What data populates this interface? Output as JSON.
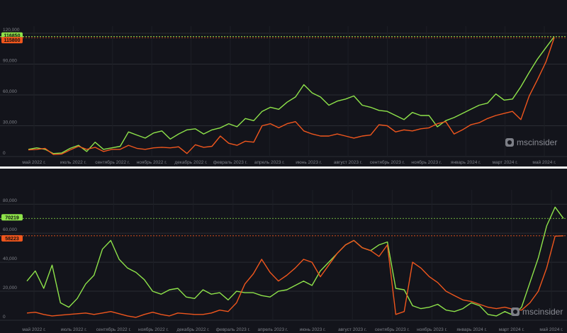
{
  "brand": "mscinsider",
  "colors": {
    "green": "#8ee34a",
    "orange": "#f0561d",
    "bg": "#13141b",
    "grid": "#2a2c33",
    "text": "#7f828a"
  },
  "chart_data": [
    {
      "type": "line",
      "x_labels": [
        "май 2022 г.",
        "июль 2022 г.",
        "сентябрь 2022 г.",
        "ноябрь 2022 г.",
        "декабрь 2022 г.",
        "февраль 2023 г.",
        "апрель 2023 г.",
        "июнь 2023 г.",
        "август 2023 г.",
        "сентябрь 2023 г.",
        "ноябрь 2023 г.",
        "январь 2024 г.",
        "март 2024 г.",
        "май 2024 г."
      ],
      "y_ticks": [
        "0",
        "30,000",
        "60,000",
        "90,000",
        "120,000"
      ],
      "ylim": [
        0,
        120000
      ],
      "last_values": [
        "116850",
        "115800"
      ],
      "series": [
        {
          "color": "#8ee34a",
          "values": [
            7000,
            8500,
            7000,
            3000,
            3500,
            8000,
            11000,
            5000,
            14000,
            7000,
            8500,
            10000,
            24000,
            21000,
            18000,
            23000,
            25000,
            17000,
            22000,
            26000,
            27000,
            22000,
            26000,
            28000,
            32000,
            29000,
            37000,
            35000,
            44000,
            48000,
            46000,
            53000,
            58000,
            70000,
            62000,
            58000,
            50000,
            54000,
            56000,
            59000,
            50000,
            48000,
            45000,
            44000,
            40000,
            36000,
            43000,
            40000,
            40000,
            29000,
            35000,
            38000,
            42000,
            46000,
            50000,
            52000,
            61000,
            55000,
            56000,
            68000,
            82000,
            95000,
            106000,
            116850
          ]
        },
        {
          "color": "#f0561d",
          "values": [
            6500,
            7000,
            8000,
            2000,
            2500,
            6500,
            10000,
            7000,
            9000,
            5000,
            7000,
            7000,
            11000,
            8000,
            7000,
            8500,
            9000,
            8500,
            9500,
            3000,
            11500,
            9000,
            10000,
            20000,
            13000,
            11000,
            15000,
            14000,
            30000,
            32000,
            28000,
            32000,
            34000,
            25000,
            22000,
            20000,
            20000,
            22000,
            20000,
            18000,
            20000,
            21000,
            31000,
            30000,
            24000,
            26000,
            25000,
            27000,
            28000,
            32000,
            34000,
            22000,
            26000,
            31000,
            33000,
            37000,
            40000,
            42000,
            44000,
            36000,
            59000,
            75000,
            92000,
            115800
          ]
        }
      ]
    },
    {
      "type": "line",
      "x_labels": [
        "май 2022 г.",
        "июль 2022 г.",
        "сентябрь 2022 г.",
        "ноябрь 2022 г.",
        "декабрь 2022 г.",
        "февраль 2023 г.",
        "апрель 2023 г.",
        "июнь 2023 г.",
        "август 2023 г.",
        "сентябрь 2023 г.",
        "ноябрь 2023 г.",
        "январь 2024 г.",
        "март 2024 г.",
        "май 2024 г."
      ],
      "y_ticks": [
        "0",
        "20,000",
        "40,000",
        "60,000",
        "80,000"
      ],
      "ylim": [
        0,
        85000
      ],
      "last_values": [
        "70219",
        "58223"
      ],
      "series": [
        {
          "color": "#8ee34a",
          "values": [
            27000,
            34000,
            22000,
            38000,
            12000,
            9000,
            15000,
            25000,
            31000,
            49000,
            55000,
            42000,
            36000,
            33000,
            28000,
            20000,
            18000,
            21000,
            22000,
            16000,
            15000,
            21000,
            18000,
            19000,
            14000,
            20000,
            19000,
            19000,
            17000,
            16000,
            20000,
            21000,
            24000,
            27000,
            24000,
            34000,
            40000,
            46000,
            52000,
            55000,
            50000,
            48000,
            52000,
            54000,
            22000,
            21000,
            10000,
            8000,
            9000,
            11000,
            7000,
            6000,
            8000,
            12000,
            10000,
            4000,
            3000,
            6000,
            3500,
            9000,
            26000,
            43000,
            65000,
            78000,
            70219
          ]
        },
        {
          "color": "#f0561d",
          "values": [
            5000,
            5500,
            4000,
            3000,
            3500,
            4000,
            4500,
            5000,
            4000,
            5000,
            6000,
            4500,
            3000,
            2000,
            4000,
            5500,
            4000,
            3000,
            5000,
            4500,
            4000,
            4000,
            5000,
            7000,
            6000,
            12000,
            25000,
            32000,
            42000,
            33000,
            27000,
            31000,
            36000,
            42000,
            40000,
            30000,
            38000,
            46000,
            52000,
            55000,
            50000,
            48000,
            44000,
            52000,
            4000,
            6000,
            40000,
            36000,
            30000,
            26000,
            20000,
            17000,
            14000,
            13000,
            11000,
            9000,
            8000,
            9000,
            7500,
            7000,
            12000,
            20000,
            36000,
            58000,
            58223
          ]
        }
      ]
    }
  ]
}
